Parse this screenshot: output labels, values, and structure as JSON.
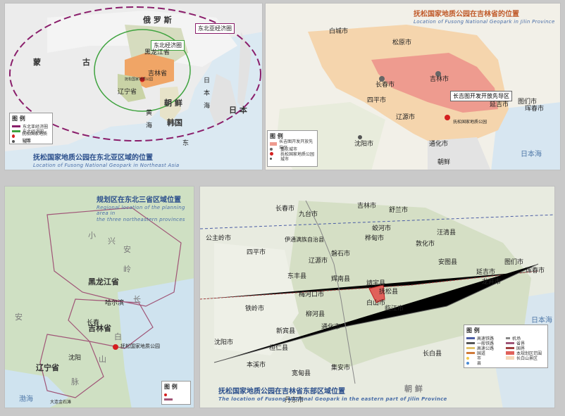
{
  "panel1": {
    "caption_zh": "抚松国家地质公园在东北亚区域的位置",
    "caption_en": "Location of Fusong National Geopark in Northeast Asia",
    "tag_northeast_asia": "东北亚经济圈",
    "tag_northeast": "东北经济圈",
    "labels": {
      "russia": "俄 罗 斯",
      "mongolia": "蒙",
      "mongolia2": "古",
      "heilongjiang": "黑龙江省",
      "jilin": "吉林省",
      "liaoning": "辽宁省",
      "park": "抚松国家地质公园",
      "korea": "朝 鲜",
      "rok": "韩国",
      "japan": "日 本",
      "japan_sea1": "日",
      "japan_sea2": "本",
      "japan_sea3": "海",
      "yellow1": "黄",
      "yellow2": "海",
      "east": "东"
    },
    "legend_title": "图 例",
    "legend_items": [
      "东北亚经济圈",
      "东北经济圈",
      "抚松国家地质公园",
      "城市"
    ]
  },
  "panel2": {
    "caption_zh": "抚松国家地质公园在吉林省的位置",
    "caption_en": "Location of Fusong National Geopark in Jilin Province",
    "tag_zone": "长吉图开发开放先导区",
    "labels": {
      "baicheng": "白城市",
      "songyuan": "松原市",
      "changchun": "长春市",
      "jilin": "吉林市",
      "siping": "四平市",
      "liaoyuan": "辽源市",
      "shenyang": "沈阳市",
      "tonghua": "通化市",
      "yanji": "延吉市",
      "tumen": "图们市",
      "hunchun": "珲春市",
      "park": "抚松国家地质公园",
      "japan_sea": "日本海",
      "korea": "朝鲜"
    },
    "legend_title": "图 例",
    "legend_items": [
      "长吉图开发开放先导区",
      "重点城市",
      "抚松国家地质公园",
      "城市"
    ]
  },
  "panel3": {
    "title_zh": "规划区在东北三省区域位置",
    "title_en1": "Regional location of the planning area in",
    "title_en2": "the three northeastern provinces",
    "labels": {
      "heilongjiang": "黑龙江省",
      "jilin": "吉林省",
      "liaoning": "辽宁省",
      "changchun": "长春",
      "harbin": "哈尔滨",
      "shenyang": "沈阳",
      "park": "抚松国家地质公园",
      "bohai": "渤海",
      "xiao": "小",
      "xing": "兴",
      "an": "安",
      "an2": "安",
      "bai": "白",
      "shan": "山",
      "chang": "长",
      "ling": "岭",
      "mai": "脉",
      "dalian": "大连金石滩"
    },
    "legend_title": "图 例"
  },
  "panel4": {
    "caption_zh": "抚松国家地质公园在吉林省东部区域位置",
    "caption_en": "The location of Fusong National Geopark in the eastern part of Jilin Province",
    "labels": {
      "changchun": "长春市",
      "jilin": "吉林市",
      "siping": "四平市",
      "liaoyuan": "辽源市",
      "meihekou": "梅河口市",
      "tonghua": "通化市",
      "baishan": "白山市",
      "yanji": "延吉市",
      "dunhua": "敦化市",
      "antu": "安图县",
      "hunchun": "珲春市",
      "fusong": "抚松县",
      "shenyang": "沈阳市",
      "dandong": "丹东市",
      "yitong": "伊通满族自治县",
      "panshi": "磐石市",
      "huadian": "桦甸市",
      "jiaohe": "蛟河市",
      "japan_sea": "日本海",
      "korea": "朝 鲜",
      "tieling": "铁岭市",
      "benxi": "本溪市",
      "xinbin": "新宾县",
      "ji_an": "集安市",
      "kuandian": "宽甸县",
      "changbai": "长白县",
      "linjiang": "临江市",
      "huanren": "桓仁县",
      "gongzhuling": "公主岭市",
      "jiutai": "九台市",
      "shulan": "舒兰市",
      "dongfeng": "东丰县",
      "huinan": "辉南县",
      "jingyu": "靖宇县",
      "liuhe": "柳河县",
      "longjing": "龙井市",
      "tumen": "图们市",
      "wangqing": "汪清县"
    },
    "legend_title": "图 例",
    "legend_items": [
      "高速铁路",
      "一般铁路",
      "高速公路",
      "国道",
      "市",
      "县",
      "机场",
      "省界",
      "国界",
      "本规划区范围",
      "长白山景区"
    ]
  }
}
